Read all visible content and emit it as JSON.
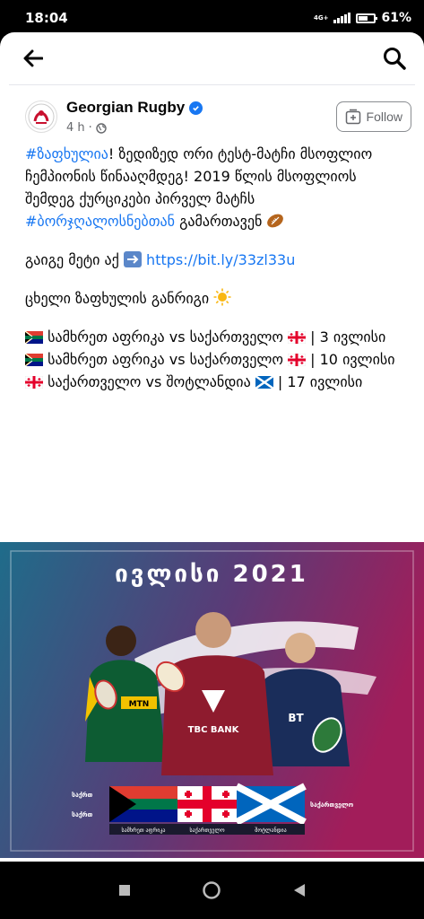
{
  "status": {
    "time": "18:04",
    "network": "4G+",
    "battery": "61%",
    "battery_level": 0.61
  },
  "header": {
    "back_icon": "arrow-left-icon",
    "search_icon": "search-icon"
  },
  "post": {
    "page_name": "Georgian Rugby",
    "time": "4 h",
    "follow_label": "Follow",
    "hashtag1": "#ზაფხულია",
    "line1_rest": "! ზედიზედ ორი ტესტ-მატჩი მსოფლიო ჩემპიონის წინააღმდეგ! 2019 წლის მსოფლიოს შემდეგ ქურციკები პირველ მატჩს ",
    "hashtag2": "#ბორჯღალოსნებთან",
    "line1_end": " გამართავენ",
    "more_label": "გაიგე მეტი აქ",
    "link": "https://bit.ly/33zl33u",
    "schedule_label": "ცხელი ზაფხულის განრიგი",
    "matches": [
      {
        "teams": " სამხრეთ აფრიკა vs საქართველო ",
        "date": "| 3 ივლისი"
      },
      {
        "teams": " სამხრეთ აფრიკა vs საქართველო ",
        "date": "| 10 ივლისი"
      },
      {
        "teams": " საქართველო vs შოტლანდია ",
        "date": "| 17 ივლისი"
      }
    ]
  },
  "poster": {
    "title": "ივლისი 2021",
    "left_top": "საქრთ",
    "left_bottom": "საქრთ",
    "right_label": "საქართველო",
    "bottom_labels": [
      "სამხრეთ აფრიკა",
      "საქართველო",
      "შოტლანდია"
    ],
    "sponsor": "TBC BANK",
    "shirt_logo": "MTN"
  },
  "colors": {
    "accent": "#1877f2",
    "poster_left": "#1f6c8a",
    "poster_right": "#a21d5a"
  }
}
